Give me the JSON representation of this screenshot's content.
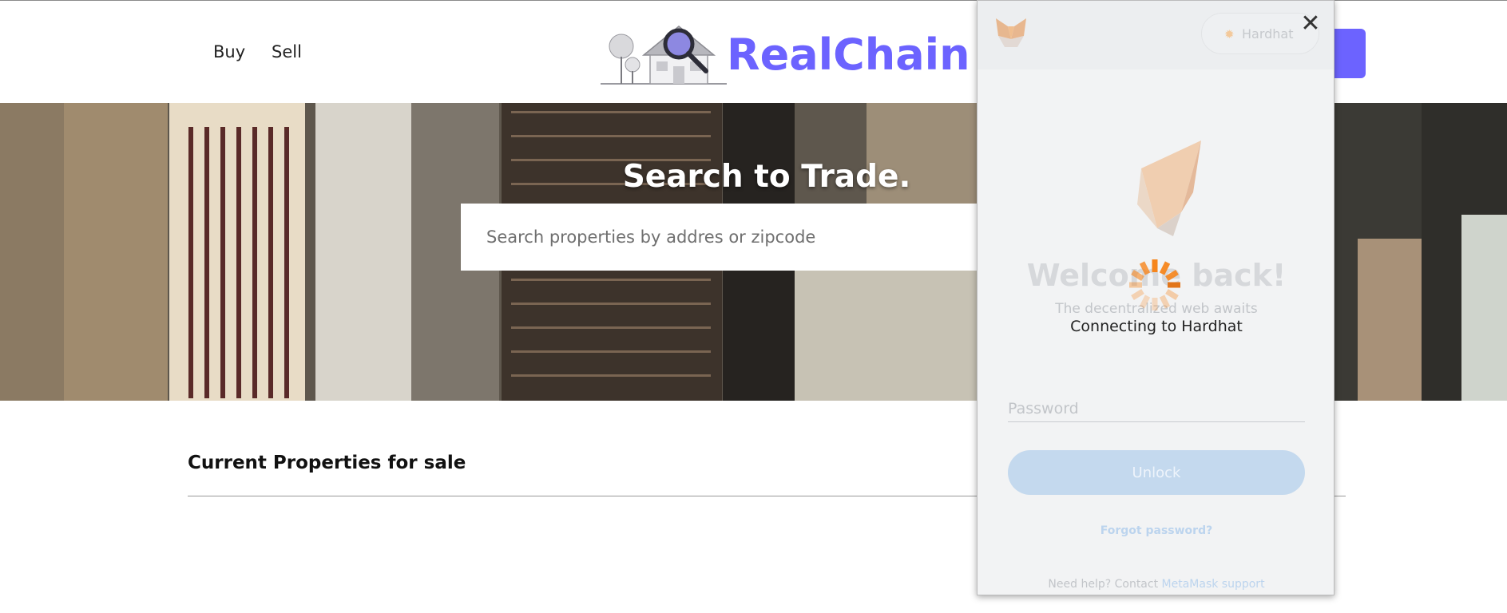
{
  "nav": {
    "buy_label": "Buy",
    "sell_label": "Sell"
  },
  "brand": {
    "name": "RealChain",
    "color": "#6c63ff"
  },
  "hero": {
    "title": "Search to Trade.",
    "search_placeholder": "Search properties by addres or zipcode",
    "search_value": ""
  },
  "listings": {
    "section_title": "Current Properties for sale"
  },
  "metamask": {
    "network_label": "Hardhat",
    "close_icon": "close-icon",
    "welcome_title": "Welcome back!",
    "welcome_subtitle": "The decentralized web awaits",
    "connecting_text": "Connecting to Hardhat",
    "password_placeholder": "Password",
    "unlock_label": "Unlock",
    "forgot_label": "Forgot password?",
    "help_prefix": "Need help? Contact ",
    "help_link": "MetaMask support"
  }
}
